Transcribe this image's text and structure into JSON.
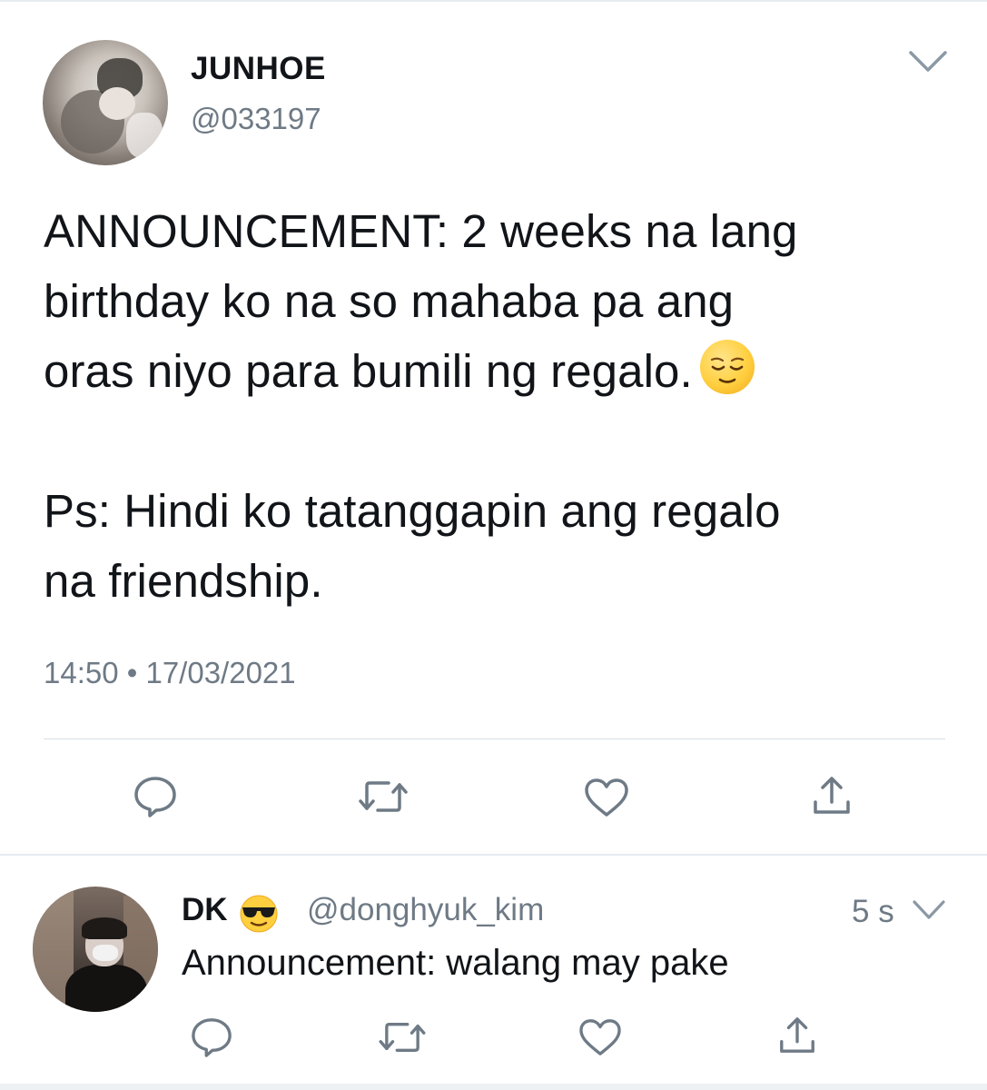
{
  "main_tweet": {
    "display_name": "JUNHOE",
    "handle": "@033197",
    "text_lines": [
      "ANNOUNCEMENT: 2 weeks na lang",
      "birthday ko na so mahaba pa ang",
      "oras niyo para bumili ng regalo."
    ],
    "text_emoji": "relieved-face-emoji",
    "text_lines_2": [
      "Ps: Hindi ko tatanggapin ang regalo",
      "na friendship."
    ],
    "timestamp": "14:50 • 17/03/2021",
    "actions": [
      "reply-icon",
      "retweet-icon",
      "like-icon",
      "share-icon"
    ]
  },
  "reply_tweet": {
    "display_name": "DK",
    "name_emoji": "sunglasses-face-emoji",
    "handle": "@donghyuk_kim",
    "time_ago": "5 s",
    "text": "Announcement: walang may pake",
    "actions": [
      "reply-icon",
      "retweet-icon",
      "like-icon",
      "share-icon"
    ]
  },
  "colors": {
    "text": "#111418",
    "secondary": "#6e7a85",
    "divider": "#d9dfe4",
    "icon": "#6e7a85"
  }
}
